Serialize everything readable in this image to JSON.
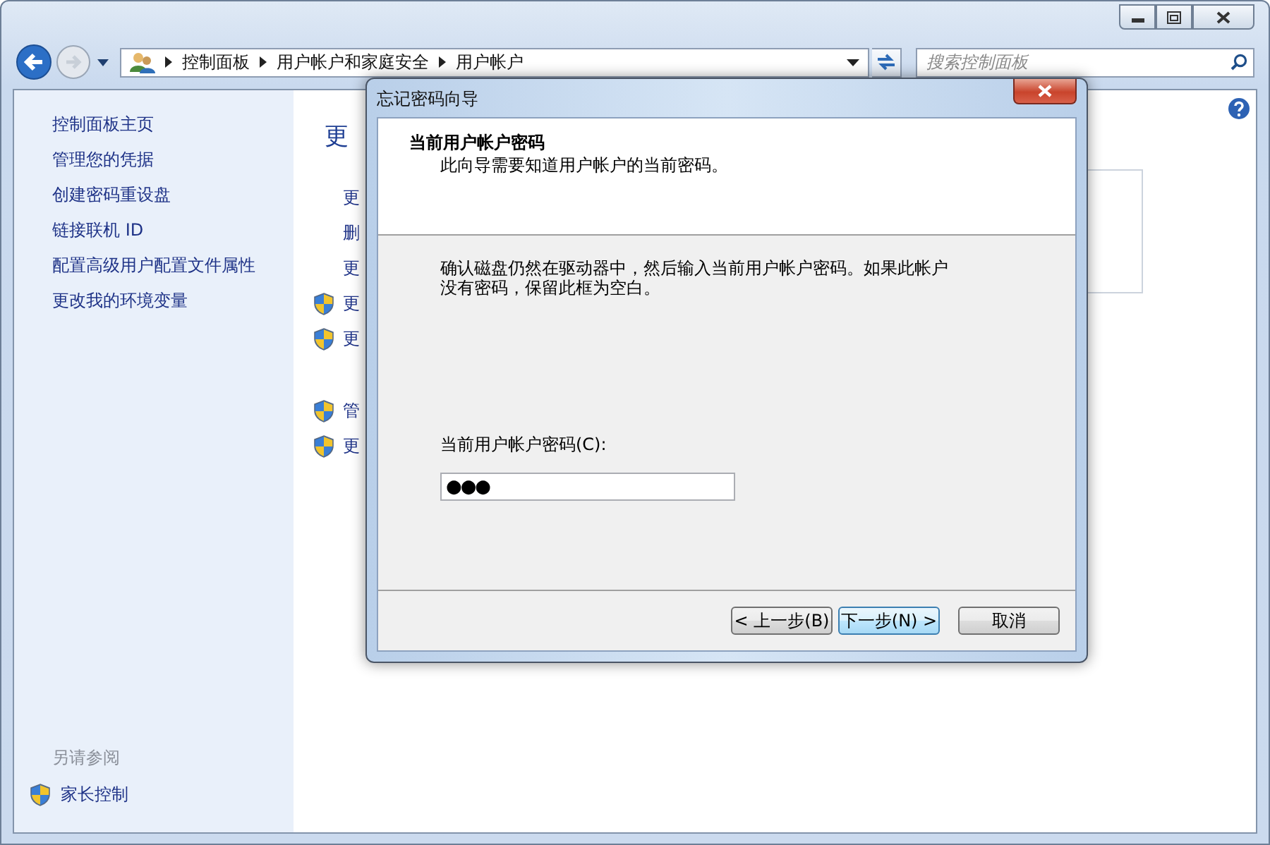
{
  "window": {
    "caption_buttons": [
      {
        "kind": "minimize"
      },
      {
        "kind": "maximize"
      },
      {
        "kind": "close"
      }
    ]
  },
  "navigation": {
    "breadcrumb": [
      "控制面板",
      "用户帐户和家庭安全",
      "用户帐户"
    ],
    "search": {
      "placeholder": "搜索控制面板"
    }
  },
  "sidebar": {
    "items": [
      "控制面板主页",
      "管理您的凭据",
      "创建密码重设盘",
      "链接联机 ID",
      "配置高级用户配置文件属性",
      "更改我的环境变量"
    ],
    "see_also": {
      "heading": "另请参阅",
      "items": [
        {
          "label": "家长控制",
          "kind": "shield"
        }
      ]
    }
  },
  "main": {
    "heading": "更",
    "links": [
      {
        "text": "更",
        "kind": "plain"
      },
      {
        "text": "删",
        "kind": "plain"
      },
      {
        "text": "更",
        "kind": "plain"
      },
      {
        "text": "更",
        "kind": "shield"
      },
      {
        "text": "更",
        "kind": "shield"
      }
    ],
    "links_2": [
      {
        "text": "管",
        "kind": "shield"
      },
      {
        "text": "更",
        "kind": "shield"
      }
    ]
  },
  "dialog": {
    "title": "忘记密码向导",
    "header_title": "当前用户帐户密码",
    "header_subtitle": "此向导需要知道用户帐户的当前密码。",
    "instructions": "确认磁盘仍然在驱动器中，然后输入当前用户帐户密码。如果此帐户没有密码，保留此框为空白。",
    "password_label": "当前用户帐户密码(C):",
    "password_value": "●●●",
    "buttons": [
      {
        "label": "< 上一步(B)",
        "focused": false
      },
      {
        "label": "下一步(N) >",
        "focused": true
      },
      {
        "label": "取消",
        "focused": false
      }
    ]
  }
}
